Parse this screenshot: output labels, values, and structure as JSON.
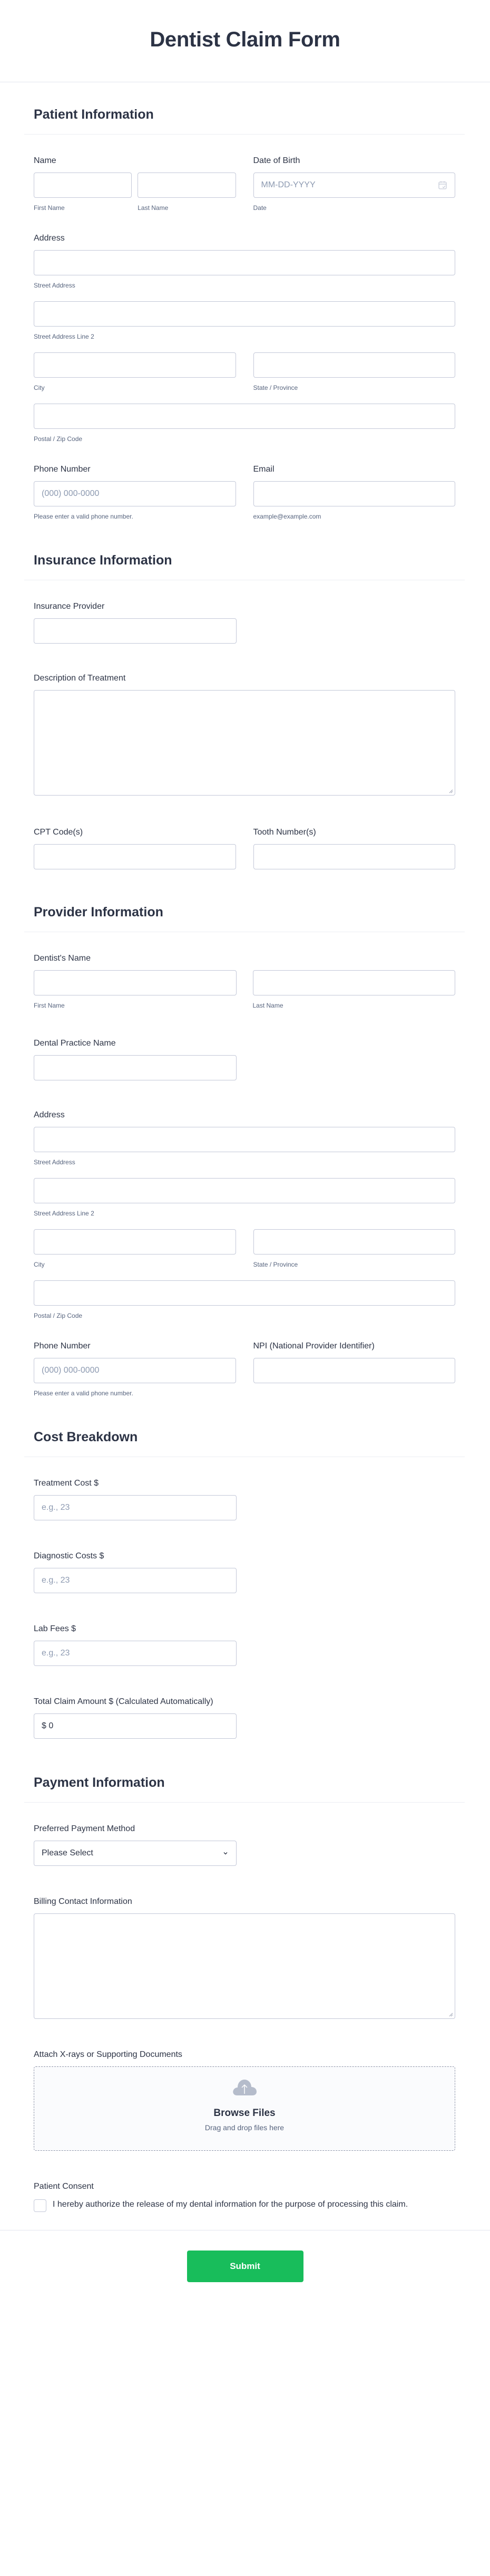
{
  "title": "Dentist Claim Form",
  "sections": {
    "patient": {
      "heading": "Patient Information",
      "name": {
        "label": "Name",
        "first_sub": "First Name",
        "last_sub": "Last Name"
      },
      "dob": {
        "label": "Date of Birth",
        "placeholder": "MM-DD-YYYY",
        "sub": "Date",
        "icon": "calendar-icon"
      },
      "address": {
        "label": "Address",
        "street_sub": "Street Address",
        "street2_sub": "Street Address Line 2",
        "city_sub": "City",
        "state_sub": "State / Province",
        "zip_sub": "Postal / Zip Code"
      },
      "phone": {
        "label": "Phone Number",
        "placeholder": "(000) 000-0000",
        "sub": "Please enter a valid phone number."
      },
      "email": {
        "label": "Email",
        "sub": "example@example.com"
      }
    },
    "insurance": {
      "heading": "Insurance Information",
      "provider_label": "Insurance Provider",
      "description_label": "Description of Treatment",
      "cpt_label": "CPT Code(s)",
      "tooth_label": "Tooth Number(s)"
    },
    "provider": {
      "heading": "Provider Information",
      "name": {
        "label": "Dentist's Name",
        "first_sub": "First Name",
        "last_sub": "Last Name"
      },
      "practice_label": "Dental Practice Name",
      "address": {
        "label": "Address",
        "street_sub": "Street Address",
        "street2_sub": "Street Address Line 2",
        "city_sub": "City",
        "state_sub": "State / Province",
        "zip_sub": "Postal / Zip Code"
      },
      "phone": {
        "label": "Phone Number",
        "placeholder": "(000) 000-0000",
        "sub": "Please enter a valid phone number."
      },
      "npi_label": "NPI (National Provider Identifier)"
    },
    "cost": {
      "heading": "Cost Breakdown",
      "treatment": {
        "label": "Treatment Cost $",
        "placeholder": "e.g., 23"
      },
      "diagnostic": {
        "label": "Diagnostic Costs $",
        "placeholder": "e.g., 23"
      },
      "lab": {
        "label": "Lab Fees $",
        "placeholder": "e.g., 23"
      },
      "total": {
        "label": "Total Claim Amount $ (Calculated Automatically)",
        "value": "$ 0"
      }
    },
    "payment": {
      "heading": "Payment Information",
      "method": {
        "label": "Preferred Payment Method",
        "selected": "Please Select"
      },
      "billing_label": "Billing Contact Information",
      "attach": {
        "label": "Attach X-rays or Supporting Documents",
        "browse": "Browse Files",
        "drag": "Drag and drop files here",
        "icon": "cloud-upload-icon"
      },
      "consent": {
        "label": "Patient Consent",
        "text": "I hereby authorize the release of my dental information for the purpose of processing this claim.",
        "checked": false
      }
    }
  },
  "submit_label": "Submit",
  "colors": {
    "accent": "#18bd5b",
    "text": "#2c3345",
    "border": "#c3c8d8",
    "sublabel": "#57647e",
    "placeholder": "#8d9ab1"
  }
}
